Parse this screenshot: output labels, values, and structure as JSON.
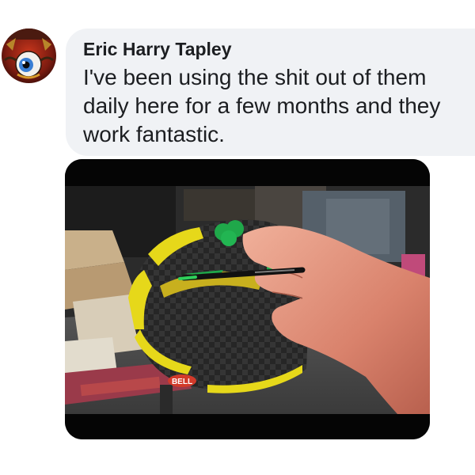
{
  "comment": {
    "author": "Eric Harry Tapley",
    "text": "I've been using the shit out of them daily here for a few months and they work fantastic.",
    "avatar": "cartoon-eyeball-avatar",
    "photo": {
      "subject": "hand painting motorcycle helmet with paint marker",
      "helmet_brand": "BELL",
      "colors": {
        "helmet_yellow": "#e6d81a",
        "helmet_green": "#1fa84a",
        "carbon": "#2a2a2a"
      }
    }
  },
  "next_comment": {
    "author_partial": ""
  },
  "colors": {
    "bubble_bg": "#f0f2f5",
    "text": "#1c1e21"
  }
}
